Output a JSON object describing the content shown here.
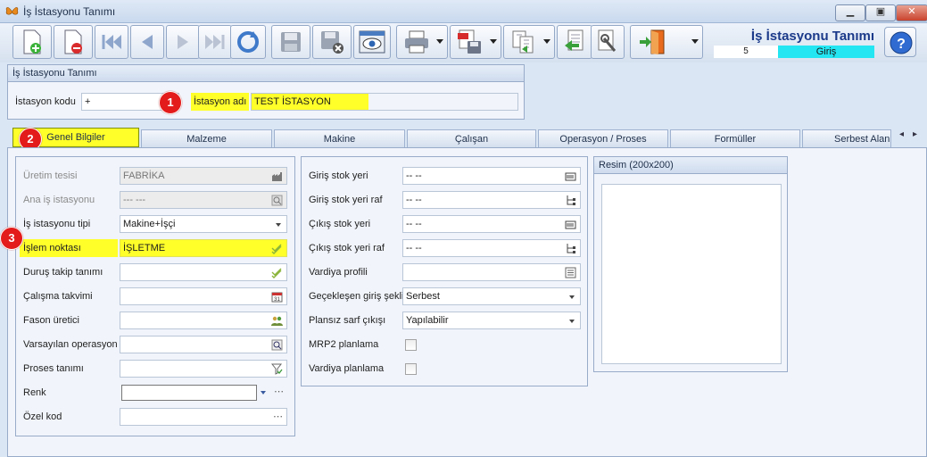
{
  "window": {
    "title": "İş İstasyonu Tanımı",
    "minimize": "▁",
    "restore": "▣",
    "close": "✕"
  },
  "header": {
    "app_title": "İş İstasyonu Tanımı",
    "record_number": "5",
    "record_mode": "Giriş",
    "mode_color": "#23e6f2"
  },
  "toolbar_icons": [
    "new-document-icon",
    "delete-document-icon",
    "first-record-icon",
    "previous-record-icon",
    "next-record-icon",
    "last-record-icon",
    "refresh-icon",
    "save-icon",
    "save-cancel-icon",
    "preview-icon",
    "print-icon",
    "pdf-export-icon",
    "copy-icon",
    "import-icon",
    "settings-icon",
    "exit-door-icon",
    "help-icon"
  ],
  "station": {
    "group_title": "İş İstasyonu Tanımı",
    "code_label": "İstasyon kodu",
    "code_value": "+",
    "name_label": "İstasyon adı",
    "name_value": "TEST İSTASYON",
    "highlight_color": "#ffff29"
  },
  "badges": [
    "1",
    "2",
    "3"
  ],
  "tabs": [
    "Genel Bilgiler",
    "Malzeme",
    "Makine",
    "Çalışan",
    "Operasyon / Proses",
    "Formüller",
    "Serbest Alanlar"
  ],
  "left_form": {
    "production_site_label": "Üretim tesisi",
    "production_site_value": "FABRİKA",
    "parent_station_label": "Ana iş istasyonu",
    "parent_station_value": "--- ---",
    "station_type_label": "İş istasyonu tipi",
    "station_type_value": "Makine+İşçi",
    "process_point_label": "İşlem noktası",
    "process_point_value": "İŞLETME",
    "downtime_label": "Duruş takip tanımı",
    "downtime_value": "",
    "calendar_label": "Çalışma takvimi",
    "calendar_value": "",
    "subcontractor_label": "Fason üretici",
    "subcontractor_value": "",
    "default_operation_label": "Varsayılan operasyon",
    "default_operation_value": "",
    "process_def_label": "Proses tanımı",
    "process_def_value": "",
    "color_label": "Renk",
    "color_value": "",
    "special_code_label": "Özel kod",
    "special_code_value": ""
  },
  "mid_form": {
    "input_stock_label": "Giriş stok yeri",
    "input_stock_value": "-- --",
    "input_shelf_label": "Giriş stok yeri raf",
    "input_shelf_value": "-- --",
    "output_stock_label": "Çıkış stok yeri",
    "output_stock_value": "-- --",
    "output_shelf_label": "Çıkış stok yeri raf",
    "output_shelf_value": "-- --",
    "shift_profile_label": "Vardiya profili",
    "shift_profile_value": "",
    "late_entry_label": "Geçekleşen giriş şekli",
    "late_entry_value": "Serbest",
    "unplanned_label": "Plansız sarf çıkışı",
    "unplanned_value": "Yapılabilir",
    "mrp2_label": "MRP2 planlama",
    "shift_planning_label": "Vardiya planlama"
  },
  "image_panel": {
    "title": "Resim (200x200)"
  },
  "tab_scroll": {
    "left": "◂",
    "right": "▸"
  }
}
